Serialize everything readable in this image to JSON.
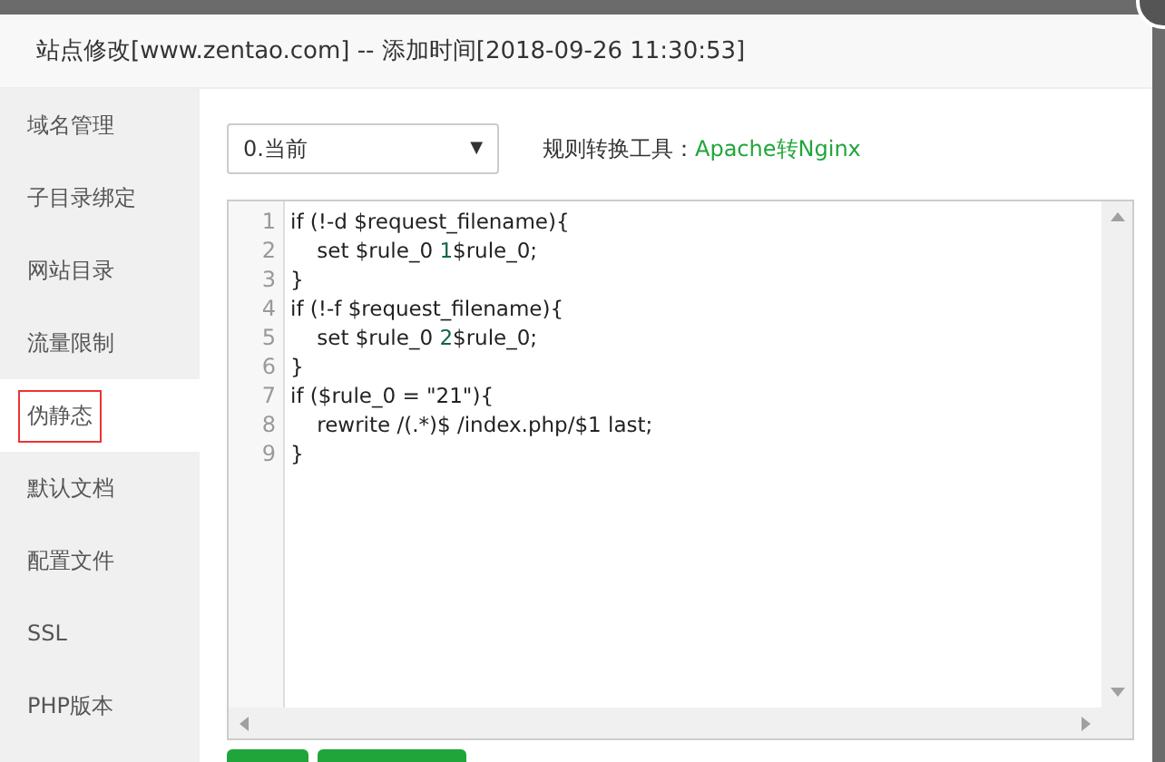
{
  "dialog": {
    "title": "站点修改[www.zentao.com] -- 添加时间[2018-09-26 11:30:53]"
  },
  "sidebar": {
    "items": [
      {
        "label": "域名管理",
        "selected": false
      },
      {
        "label": "子目录绑定",
        "selected": false
      },
      {
        "label": "网站目录",
        "selected": false
      },
      {
        "label": "流量限制",
        "selected": false
      },
      {
        "label": "伪静态",
        "selected": true
      },
      {
        "label": "默认文档",
        "selected": false
      },
      {
        "label": "配置文件",
        "selected": false
      },
      {
        "label": "SSL",
        "selected": false
      },
      {
        "label": "PHP版本",
        "selected": false
      }
    ]
  },
  "rule_select": {
    "value": "0.当前",
    "caret": "▼"
  },
  "converter": {
    "label": "规则转换工具：",
    "link": "Apache转Nginx"
  },
  "editor": {
    "lines": [
      {
        "number": "1",
        "segments": [
          {
            "kind": "text",
            "text": "if (!-d $request_filename){"
          }
        ]
      },
      {
        "number": "2",
        "segments": [
          {
            "kind": "text",
            "text": "    set $rule_0 "
          },
          {
            "kind": "number",
            "text": "1"
          },
          {
            "kind": "text",
            "text": "$rule_0;"
          }
        ]
      },
      {
        "number": "3",
        "segments": [
          {
            "kind": "text",
            "text": "}"
          }
        ]
      },
      {
        "number": "4",
        "segments": [
          {
            "kind": "text",
            "text": "if (!-f $request_filename){"
          }
        ]
      },
      {
        "number": "5",
        "segments": [
          {
            "kind": "text",
            "text": "    set $rule_0 "
          },
          {
            "kind": "number",
            "text": "2"
          },
          {
            "kind": "text",
            "text": "$rule_0;"
          }
        ]
      },
      {
        "number": "6",
        "segments": [
          {
            "kind": "text",
            "text": "}"
          }
        ]
      },
      {
        "number": "7",
        "segments": [
          {
            "kind": "text",
            "text": "if ($rule_0 = \"21\"){"
          }
        ]
      },
      {
        "number": "8",
        "segments": [
          {
            "kind": "text",
            "text": "    rewrite /(.*)$ /index.php/$1 last;"
          }
        ]
      },
      {
        "number": "9",
        "segments": [
          {
            "kind": "text",
            "text": "}"
          }
        ]
      }
    ]
  },
  "buttons": [
    {
      "kind": "primary"
    },
    {
      "kind": "primary"
    }
  ]
}
